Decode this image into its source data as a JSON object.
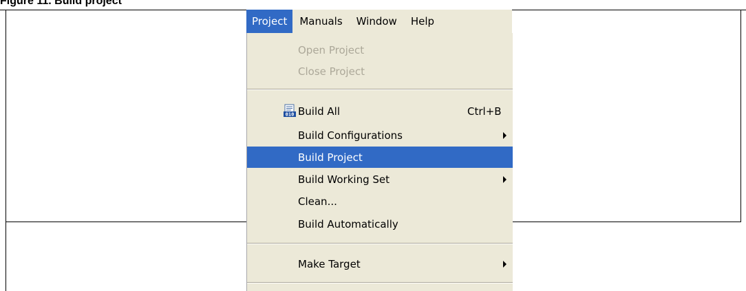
{
  "caption": "Figure 11. Build project",
  "menubar": {
    "items": [
      {
        "label": "Project",
        "active": true
      },
      {
        "label": "Manuals"
      },
      {
        "label": "Window"
      },
      {
        "label": "Help"
      }
    ]
  },
  "menu": {
    "open_project": "Open Project",
    "close_project": "Close Project",
    "build_all": {
      "label": "Build All",
      "shortcut": "Ctrl+B",
      "icon": "build-all-icon"
    },
    "build_configurations": "Build Configurations",
    "build_project": "Build Project",
    "build_working_set": "Build Working Set",
    "clean": "Clean...",
    "build_automatically": "Build Automatically",
    "make_target": "Make Target"
  },
  "colors": {
    "menu_bg": "#ece9d8",
    "highlight": "#316ac5",
    "disabled_text": "#aca899"
  }
}
